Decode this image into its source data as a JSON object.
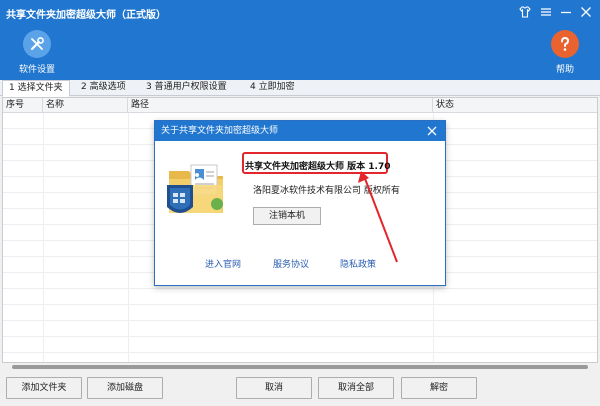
{
  "window": {
    "title": "共享文件夹加密超级大师（正式版）"
  },
  "toolbar": {
    "settings_label": "软件设置",
    "help_label": "帮助"
  },
  "tabs": [
    {
      "label": "1 选择文件夹"
    },
    {
      "label": "2 高级选项"
    },
    {
      "label": "3 普通用户权限设置"
    },
    {
      "label": "4 立即加密"
    }
  ],
  "table": {
    "columns": [
      "序号",
      "名称",
      "路径",
      "状态"
    ]
  },
  "buttons": {
    "add_folder": "添加文件夹",
    "add_disk": "添加磁盘",
    "cancel": "取消",
    "cancel_all": "取消全部",
    "decrypt": "解密"
  },
  "about_dialog": {
    "title": "关于共享文件夹加密超级大师",
    "product_line": "共享文件夹加密超级大师 版本 1.70",
    "company": "洛阳夏冰软件技术有限公司 版权所有",
    "unregister_button": "注销本机",
    "links": [
      "进入官网",
      "服务协议",
      "隐私政策"
    ]
  },
  "colors": {
    "header_blue": "#2177cf",
    "settings_icon_bg": "#5aa3e8",
    "help_icon_bg": "#e8632f",
    "callout_red": "#e3262b",
    "link_blue": "#2a5db0"
  }
}
